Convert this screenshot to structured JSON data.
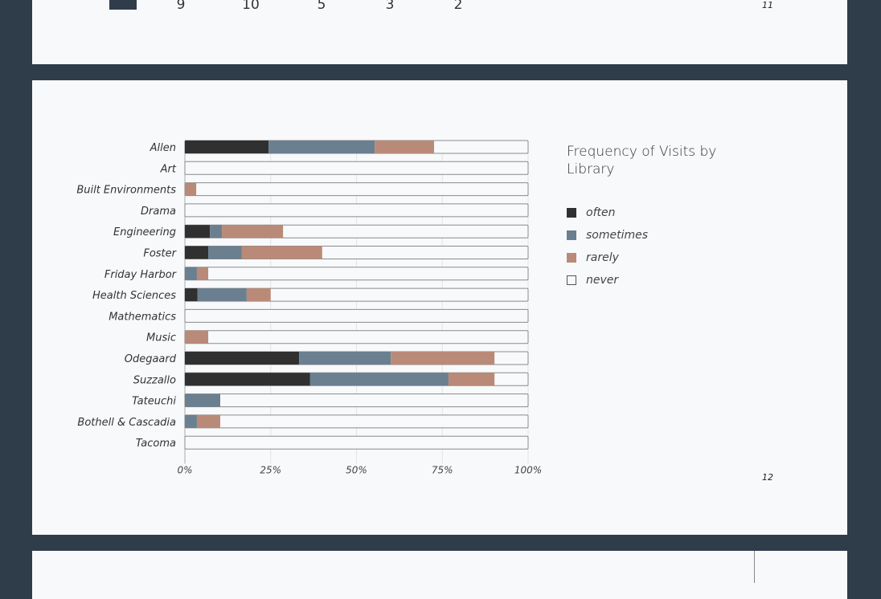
{
  "previous_page": {
    "values": [
      "9",
      "10",
      "5",
      "3",
      "2"
    ],
    "page_number": "11"
  },
  "page_number": "12",
  "colors": {
    "background": "#2f3c4a",
    "page": "#f8f9fb",
    "often": "#303030",
    "sometimes": "#6a7f90",
    "rarely": "#b98a77",
    "never": "#f8f9fb"
  },
  "chart_data": {
    "type": "bar",
    "orientation": "horizontal",
    "stacked": true,
    "title": "Frequency of Visits by Library",
    "xlabel": "",
    "ylabel": "",
    "xlim": [
      0,
      100
    ],
    "x_ticks": [
      "0%",
      "25%",
      "50%",
      "75%",
      "100%"
    ],
    "grid": true,
    "legend_position": "right",
    "categories": [
      "Allen",
      "Art",
      "Built Environments",
      "Drama",
      "Engineering",
      "Foster",
      "Friday Harbor",
      "Health Sciences",
      "Mathematics",
      "Music",
      "Odegaard",
      "Suzzallo",
      "Tateuchi",
      "Bothell & Cascadia",
      "Tacoma"
    ],
    "series": [
      {
        "name": "often",
        "values": [
          24.4,
          0,
          0,
          0,
          7.3,
          6.8,
          0,
          3.7,
          0,
          0,
          33.3,
          36.5,
          0,
          0,
          0
        ]
      },
      {
        "name": "sometimes",
        "values": [
          30.9,
          0,
          0,
          0,
          3.5,
          9.8,
          3.5,
          14.3,
          0,
          0,
          26.7,
          40.3,
          10.3,
          3.5,
          0
        ]
      },
      {
        "name": "rarely",
        "values": [
          17.3,
          0,
          3.3,
          0,
          17.8,
          23.4,
          3.3,
          7.0,
          0,
          6.8,
          30.2,
          13.4,
          0,
          6.8,
          0
        ]
      },
      {
        "name": "never",
        "values": [
          27.4,
          100,
          96.7,
          100,
          71.4,
          60.0,
          93.2,
          75.0,
          100,
          93.2,
          9.8,
          9.8,
          89.7,
          89.7,
          100
        ]
      }
    ]
  }
}
